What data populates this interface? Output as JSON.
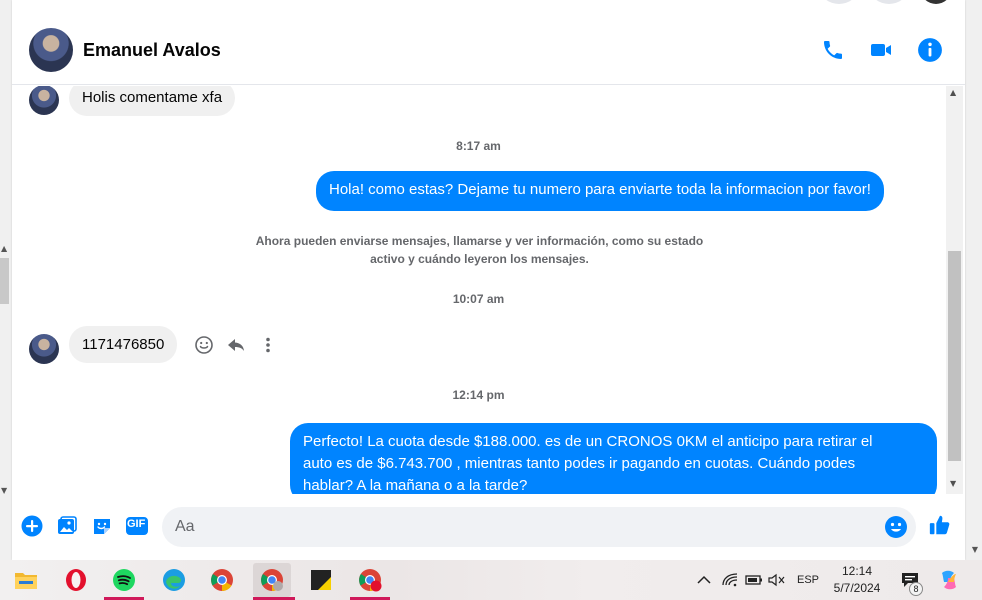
{
  "contact": {
    "name": "Emanuel Avalos"
  },
  "messages": {
    "first_incoming": "Holis comentame xfa",
    "time_1": "8:17 am",
    "outgoing_1": "Hola! como estas? Dejame tu numero para enviarte toda la informacion por favor!",
    "system_note_line1": "Ahora pueden enviarse mensajes, llamarse y ver información, como su estado",
    "system_note_line2": "activo y cuándo leyeron los mensajes.",
    "time_2": "10:07 am",
    "incoming_number": "1171476850",
    "time_3": "12:14 pm",
    "outgoing_2_line1": "Perfecto! La cuota desde $188.000. es de un CRONOS 0KM el anticipo para retirar el",
    "outgoing_2_line2": "auto es de $6.743.700 , mientras tanto podes ir pagando en cuotas. Cuándo podes",
    "outgoing_2_line3": "hablar? A la mañana o a la tarde?"
  },
  "composer": {
    "placeholder": "Aa",
    "gif_label": "GIF"
  },
  "taskbar": {
    "language": "ESP",
    "time": "12:14",
    "date": "5/7/2024",
    "notification_count": "8",
    "apps": [
      "file-explorer",
      "opera",
      "spotify",
      "edge",
      "chrome",
      "chrome-profile",
      "sticky-notes",
      "chrome-2"
    ]
  },
  "colors": {
    "accent": "#0084ff",
    "bubble_in": "#f0f0f0",
    "text_muted": "#65676b"
  }
}
